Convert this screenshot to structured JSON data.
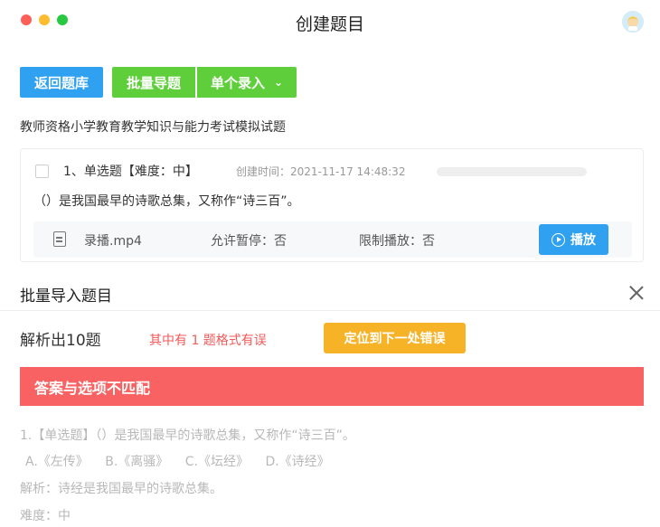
{
  "window": {
    "title": "创建题目"
  },
  "toolbar": {
    "back_label": "返回题库",
    "batch_label": "批量导题",
    "single_label": "单个录入",
    "single_chevron": "⌄"
  },
  "exam": {
    "title": "教师资格小学教育教学知识与能力考试模拟试题"
  },
  "question": {
    "heading": "1、单选题【难度：中】",
    "created": "创建时间：2021-11-17 14:48:32",
    "text": "（）是我国最早的诗歌总集，又称作“诗三百”。",
    "media": {
      "name": "录播.mp4",
      "pause": "允许暂停：否",
      "limit": "限制播放：否",
      "play_label": "播放"
    }
  },
  "import": {
    "title": "批量导入题目",
    "parsed": "解析出10题",
    "error_note": "其中有 1 题格式有误",
    "locate_label": "定位到下一处错误",
    "error_banner": "答案与选项不匹配",
    "preview": {
      "question": "1.【单选题】（）是我国最早的诗歌总集，又称作“诗三百”。",
      "options": [
        "A.《左传》",
        "B.《离骚》",
        "C.《坛经》",
        "D.《诗经》"
      ],
      "analysis": "解析：诗经是我国最早的诗歌总集。",
      "difficulty": "难度：中"
    }
  },
  "colors": {
    "blue": "#2fa1f0",
    "green": "#5ecf3a",
    "orange": "#f6b328",
    "red": "#f96262"
  }
}
